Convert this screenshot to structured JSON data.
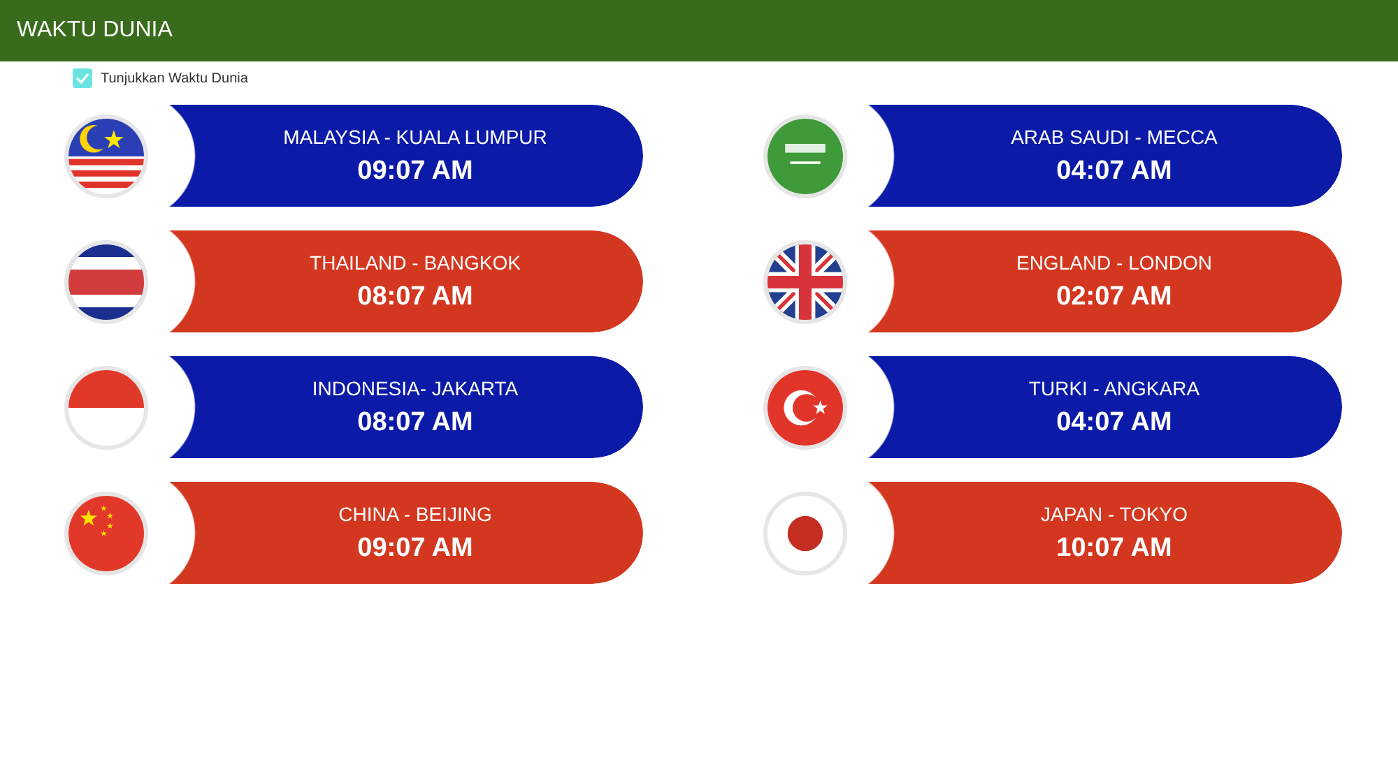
{
  "header": {
    "title": "WAKTU DUNIA"
  },
  "toggle": {
    "label": "Tunjukkan Waktu Dunia",
    "checked": true
  },
  "clocks": [
    {
      "place": "MALAYSIA - KUALA LUMPUR",
      "time": "09:07 AM",
      "color": "#0c1aa8"
    },
    {
      "place": "ARAB SAUDI - MECCA",
      "time": "04:07 AM",
      "color": "#0c1aa8"
    },
    {
      "place": "THAILAND - BANGKOK",
      "time": "08:07 AM",
      "color": "#d3371f"
    },
    {
      "place": "ENGLAND - LONDON",
      "time": "02:07 AM",
      "color": "#d3371f"
    },
    {
      "place": "INDONESIA- JAKARTA",
      "time": "08:07 AM",
      "color": "#0c1aa8"
    },
    {
      "place": "TURKI - ANGKARA",
      "time": "04:07 AM",
      "color": "#0c1aa8"
    },
    {
      "place": "CHINA - BEIJING",
      "time": "09:07 AM",
      "color": "#d3371f"
    },
    {
      "place": "JAPAN - TOKYO",
      "time": "10:07 AM",
      "color": "#d3371f"
    }
  ]
}
